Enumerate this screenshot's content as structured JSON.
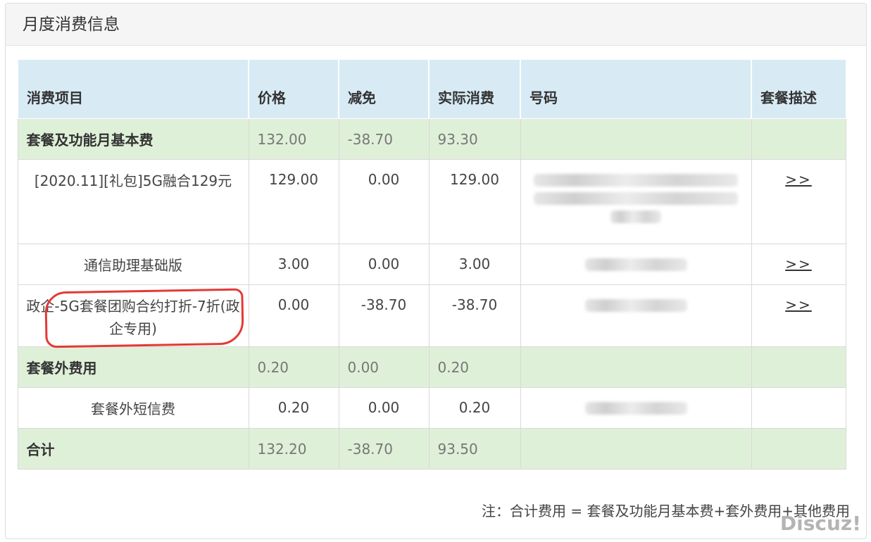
{
  "panel": {
    "title": "月度消费信息"
  },
  "table": {
    "headers": [
      "消费项目",
      "价格",
      "减免",
      "实际消费",
      "号码",
      "套餐描述"
    ],
    "groups": [
      {
        "name": "套餐及功能月基本费",
        "price": "132.00",
        "discount": "-38.70",
        "actual": "93.30",
        "items": [
          {
            "name": "[2020.11][礼包]5G融合129元",
            "price": "129.00",
            "discount": "0.00",
            "actual": "129.00",
            "link": ">>"
          },
          {
            "name": "通信助理基础版",
            "price": "3.00",
            "discount": "0.00",
            "actual": "3.00",
            "link": ">>"
          },
          {
            "name": "政企-5G套餐团购合约打折-7折(政企专用)",
            "price": "0.00",
            "discount": "-38.70",
            "actual": "-38.70",
            "link": ">>"
          }
        ]
      },
      {
        "name": "套餐外费用",
        "price": "0.20",
        "discount": "0.00",
        "actual": "0.20",
        "items": [
          {
            "name": "套餐外短信费",
            "price": "0.20",
            "discount": "0.00",
            "actual": "0.20",
            "link": ""
          }
        ]
      }
    ],
    "total": {
      "name": "合计",
      "price": "132.20",
      "discount": "-38.70",
      "actual": "93.50"
    }
  },
  "note": "注：合计费用 = 套餐及功能月基本费+套外费用+其他费用",
  "watermark": "Discuz!",
  "colors": {
    "header_bg": "#d8ebf5",
    "group_bg": "#dff0d8",
    "annotation": "#e53935"
  }
}
